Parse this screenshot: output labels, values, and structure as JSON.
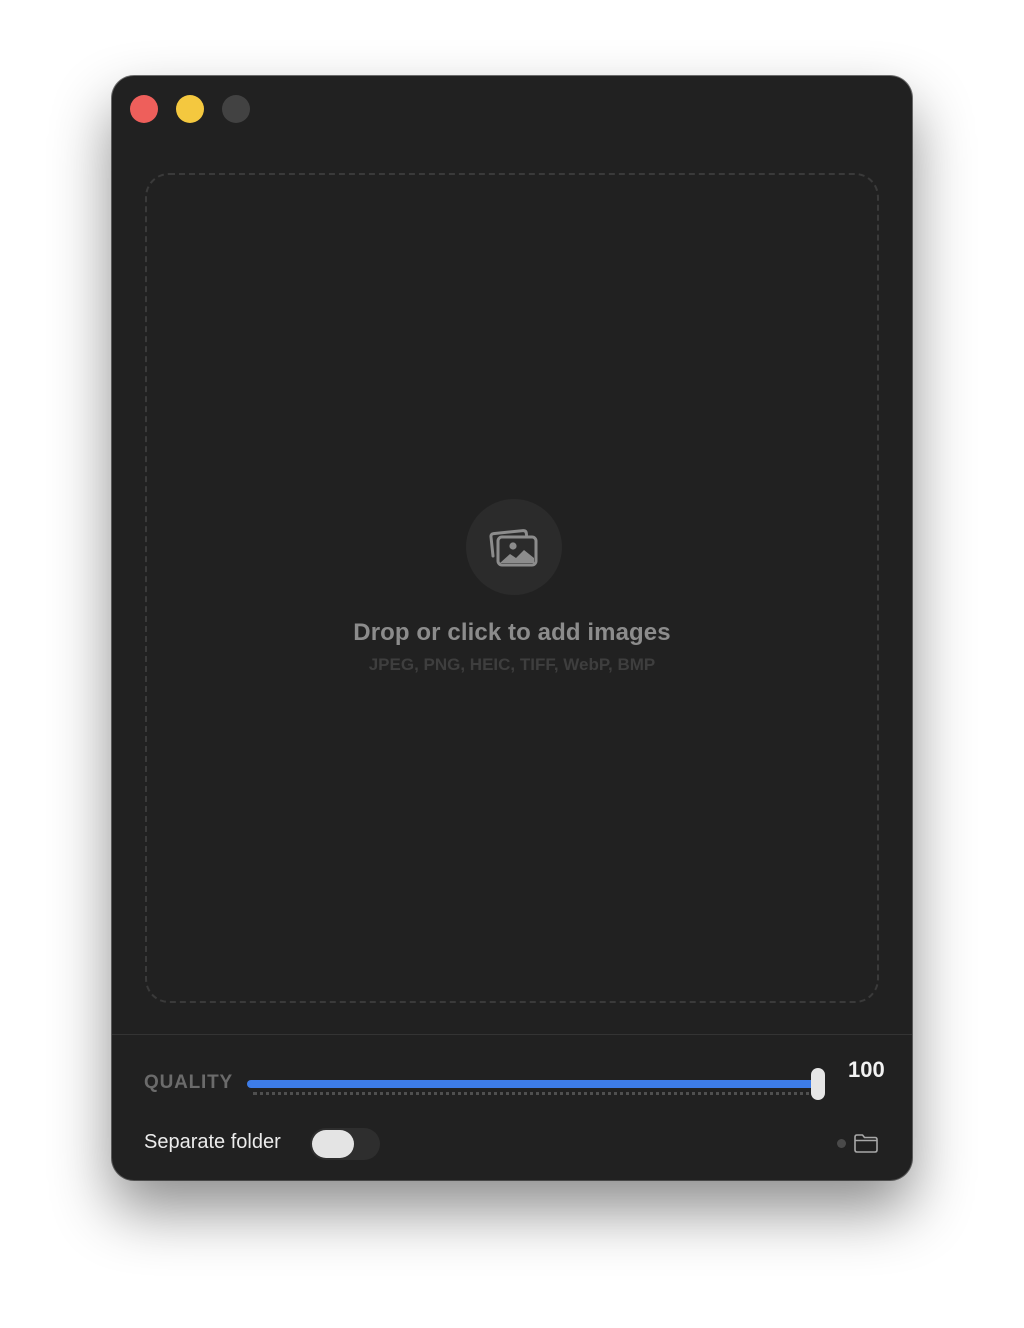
{
  "window": {
    "controls": [
      "close",
      "minimize",
      "zoom"
    ]
  },
  "dropzone": {
    "icon": "photos-icon",
    "title": "Drop or click to add images",
    "formats": "JPEG, PNG, HEIC, TIFF, WebP, BMP"
  },
  "quality": {
    "label": "QUALITY",
    "value": 100,
    "value_text": "100",
    "min": 0,
    "max": 100
  },
  "output": {
    "separate_folder_label": "Separate folder",
    "separate_folder_on": false,
    "folder_icon": "folder-icon"
  },
  "colors": {
    "window_bg": "#212121",
    "accent": "#3d7ce8",
    "close": "#ee5f5b",
    "minimize": "#f4c83f",
    "zoom_disabled": "#424242"
  }
}
